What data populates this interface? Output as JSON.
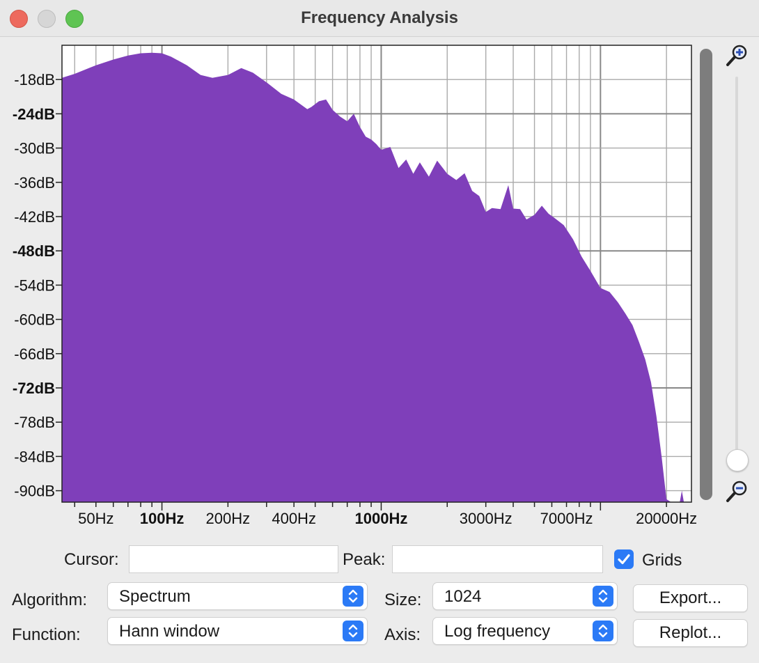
{
  "window": {
    "title": "Frequency Analysis"
  },
  "colors": {
    "spectrum": "#7f3fba",
    "accent": "#2b7af6",
    "grid": "#aaaaaa",
    "plot_bg": "#ffffff"
  },
  "chart_data": {
    "type": "area",
    "x_scale": "log",
    "xlim": [
      35,
      26000
    ],
    "ylim": [
      -92,
      -12
    ],
    "grid": true,
    "y_ticks": [
      {
        "value": -18,
        "label": "-18dB"
      },
      {
        "value": -24,
        "label": "-24dB"
      },
      {
        "value": -30,
        "label": "-30dB"
      },
      {
        "value": -36,
        "label": "-36dB"
      },
      {
        "value": -42,
        "label": "-42dB"
      },
      {
        "value": -48,
        "label": "-48dB"
      },
      {
        "value": -54,
        "label": "-54dB"
      },
      {
        "value": -60,
        "label": "-60dB"
      },
      {
        "value": -66,
        "label": "-66dB"
      },
      {
        "value": -72,
        "label": "-72dB"
      },
      {
        "value": -78,
        "label": "-78dB"
      },
      {
        "value": -84,
        "label": "-84dB"
      },
      {
        "value": -90,
        "label": "-90dB"
      }
    ],
    "x_ticks": [
      {
        "value": 50,
        "label": "50Hz"
      },
      {
        "value": 100,
        "label": "100Hz"
      },
      {
        "value": 200,
        "label": "200Hz"
      },
      {
        "value": 400,
        "label": "400Hz"
      },
      {
        "value": 1000,
        "label": "1000Hz"
      },
      {
        "value": 3000,
        "label": "3000Hz"
      },
      {
        "value": 7000,
        "label": "7000Hz"
      },
      {
        "value": 20000,
        "label": "20000Hz"
      }
    ],
    "x": [
      35,
      40,
      50,
      60,
      70,
      80,
      90,
      100,
      110,
      130,
      150,
      170,
      200,
      230,
      260,
      300,
      350,
      400,
      460,
      480,
      520,
      560,
      600,
      650,
      700,
      750,
      800,
      850,
      900,
      950,
      1000,
      1100,
      1200,
      1300,
      1400,
      1500,
      1650,
      1800,
      2000,
      2200,
      2400,
      2600,
      2800,
      3000,
      3200,
      3500,
      3800,
      4000,
      4300,
      4600,
      5000,
      5400,
      5800,
      6200,
      6800,
      7500,
      8200,
      9000,
      10000,
      11000,
      12000,
      13000,
      14000,
      15000,
      16000,
      17000,
      18000,
      19000,
      20000,
      21000,
      22000,
      23000,
      23500,
      24000,
      25000,
      26000
    ],
    "values": [
      -17.7,
      -17,
      -15.5,
      -14.5,
      -13.8,
      -13.4,
      -13.3,
      -13.4,
      -14,
      -15.5,
      -17.2,
      -17.7,
      -17.2,
      -16,
      -16.8,
      -18.5,
      -20.5,
      -21.5,
      -23.2,
      -22.8,
      -21.8,
      -21.5,
      -23.3,
      -24.5,
      -25.3,
      -24,
      -26.3,
      -28,
      -28.5,
      -29.3,
      -30.3,
      -29.8,
      -33.5,
      -32,
      -34.5,
      -32.5,
      -35,
      -32.2,
      -34.5,
      -35.6,
      -34.4,
      -37.5,
      -38.4,
      -41.2,
      -40.5,
      -40.7,
      -36.5,
      -40.6,
      -40.7,
      -42.5,
      -41.7,
      -40.1,
      -41.5,
      -42.3,
      -43.5,
      -46,
      -49,
      -51.5,
      -54.5,
      -55.2,
      -57,
      -59,
      -61,
      -64,
      -67,
      -71,
      -77,
      -84,
      -91.5,
      -92,
      -92,
      -92,
      -90,
      -92,
      -92,
      -92
    ]
  },
  "controls": {
    "cursor_label": "Cursor:",
    "cursor_value": "",
    "peak_label": "Peak:",
    "peak_value": "",
    "grids_label": "Grids",
    "grids_checked": true,
    "algorithm_label": "Algorithm:",
    "algorithm_value": "Spectrum",
    "function_label": "Function:",
    "function_value": "Hann window",
    "size_label": "Size:",
    "size_value": "1024",
    "axis_label": "Axis:",
    "axis_value": "Log frequency",
    "export_label": "Export...",
    "replot_label": "Replot..."
  }
}
